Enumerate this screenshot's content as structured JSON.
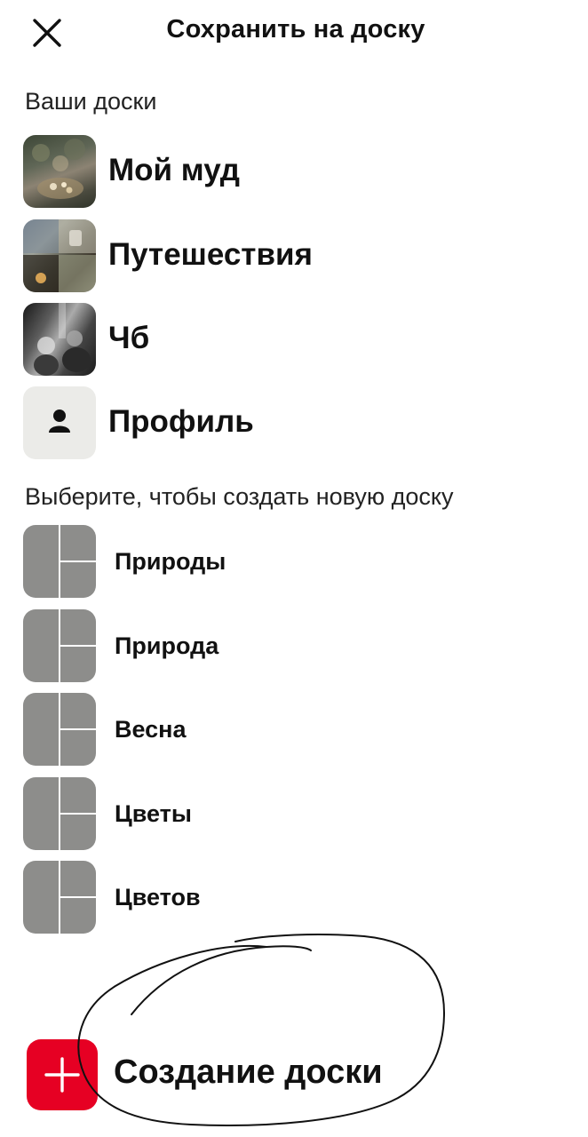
{
  "header": {
    "title": "Сохранить на доску",
    "close_icon": "close-icon"
  },
  "boards_section": {
    "label": "Ваши доски",
    "items": [
      {
        "name": "Мой муд",
        "thumb": "photo"
      },
      {
        "name": "Путешествия",
        "thumb": "photo"
      },
      {
        "name": "Чб",
        "thumb": "photo"
      },
      {
        "name": "Профиль",
        "thumb": "person-icon"
      }
    ]
  },
  "suggest_section": {
    "label": "Выберите, чтобы создать новую доску",
    "items": [
      {
        "name": "Природы"
      },
      {
        "name": "Природа"
      },
      {
        "name": "Весна"
      },
      {
        "name": "Цветы"
      },
      {
        "name": "Цветов"
      }
    ]
  },
  "create": {
    "label": "Создание доски",
    "icon": "plus-icon"
  },
  "colors": {
    "accent": "#e60023",
    "placeholder_gray": "#8d8d8b",
    "profile_bg": "#ebebe8",
    "text": "#111111"
  }
}
